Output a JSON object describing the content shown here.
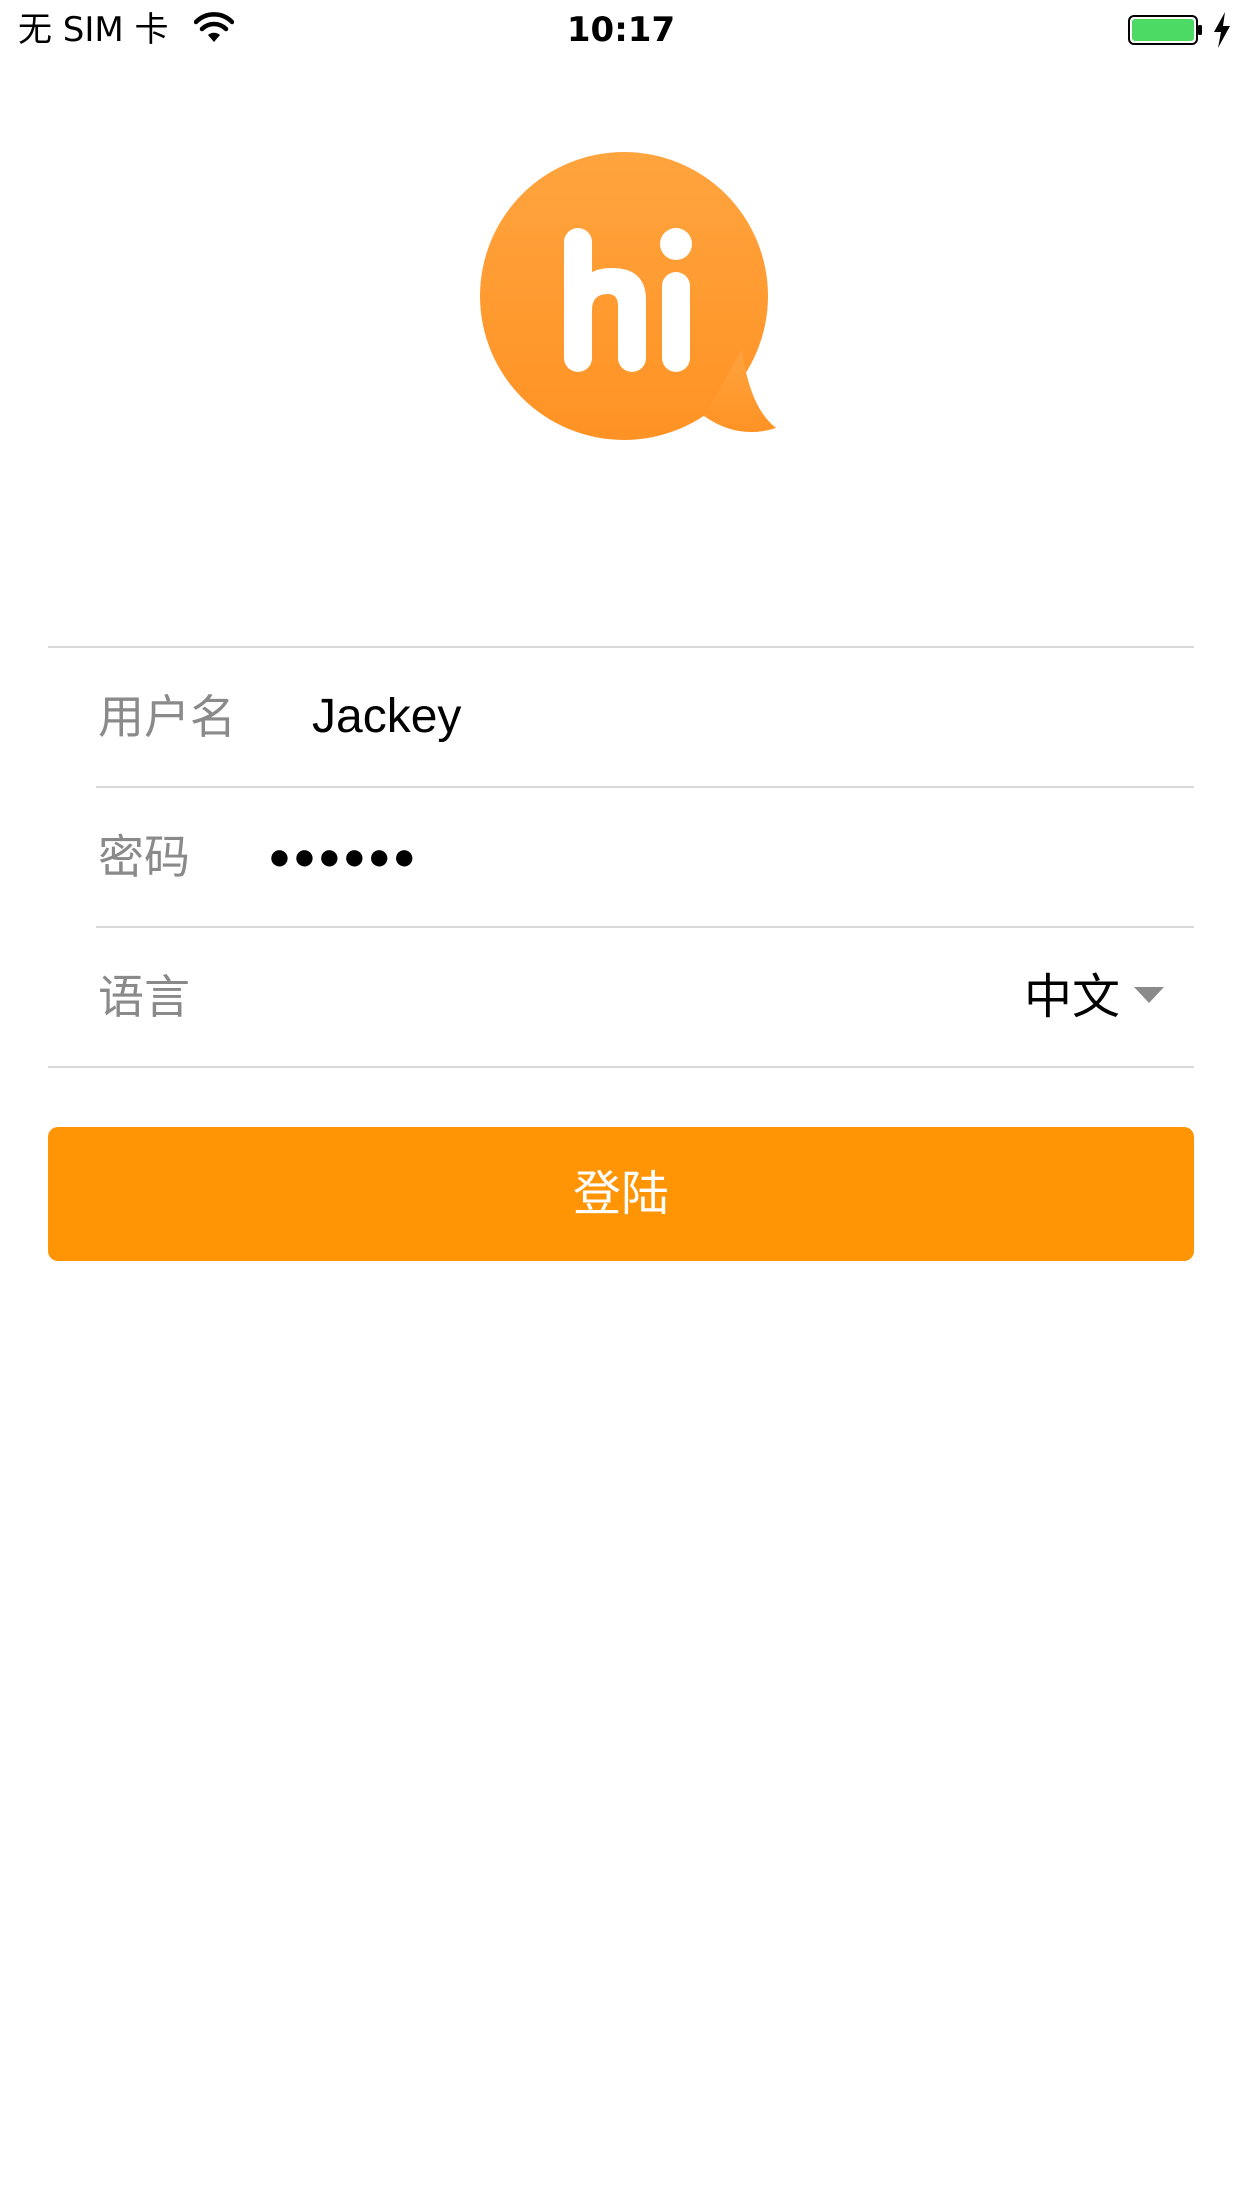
{
  "status_bar": {
    "carrier": "无 SIM 卡",
    "time": "10:17",
    "wifi_icon": "wifi-icon",
    "battery_icon": "battery-icon",
    "battery_color": "#4cd964",
    "charging_icon": "charging-bolt-icon"
  },
  "logo": {
    "text": "hi",
    "color": "#ff9a30",
    "icon": "speech-bubble-logo"
  },
  "form": {
    "username": {
      "label": "用户名",
      "value": "Jackey"
    },
    "password": {
      "label": "密码",
      "masked_value": "●●●●●●"
    },
    "language": {
      "label": "语言",
      "selected": "中文",
      "dropdown_icon": "caret-down-icon"
    }
  },
  "login_button": {
    "label": "登陆",
    "color": "#ff9405"
  },
  "divider_color": "#d9d9d9",
  "label_color": "#8a8a8a"
}
